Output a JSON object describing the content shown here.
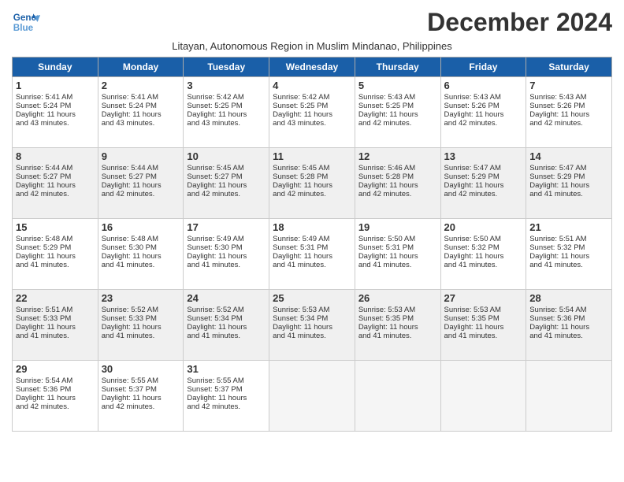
{
  "header": {
    "logo_line1": "General",
    "logo_line2": "Blue",
    "month_year": "December 2024",
    "location": "Litayan, Autonomous Region in Muslim Mindanao, Philippines"
  },
  "weekdays": [
    "Sunday",
    "Monday",
    "Tuesday",
    "Wednesday",
    "Thursday",
    "Friday",
    "Saturday"
  ],
  "weeks": [
    [
      {
        "day": 1,
        "lines": [
          "Sunrise: 5:41 AM",
          "Sunset: 5:24 PM",
          "Daylight: 11 hours",
          "and 43 minutes."
        ]
      },
      {
        "day": 2,
        "lines": [
          "Sunrise: 5:41 AM",
          "Sunset: 5:24 PM",
          "Daylight: 11 hours",
          "and 43 minutes."
        ]
      },
      {
        "day": 3,
        "lines": [
          "Sunrise: 5:42 AM",
          "Sunset: 5:25 PM",
          "Daylight: 11 hours",
          "and 43 minutes."
        ]
      },
      {
        "day": 4,
        "lines": [
          "Sunrise: 5:42 AM",
          "Sunset: 5:25 PM",
          "Daylight: 11 hours",
          "and 43 minutes."
        ]
      },
      {
        "day": 5,
        "lines": [
          "Sunrise: 5:43 AM",
          "Sunset: 5:25 PM",
          "Daylight: 11 hours",
          "and 42 minutes."
        ]
      },
      {
        "day": 6,
        "lines": [
          "Sunrise: 5:43 AM",
          "Sunset: 5:26 PM",
          "Daylight: 11 hours",
          "and 42 minutes."
        ]
      },
      {
        "day": 7,
        "lines": [
          "Sunrise: 5:43 AM",
          "Sunset: 5:26 PM",
          "Daylight: 11 hours",
          "and 42 minutes."
        ]
      }
    ],
    [
      {
        "day": 8,
        "lines": [
          "Sunrise: 5:44 AM",
          "Sunset: 5:27 PM",
          "Daylight: 11 hours",
          "and 42 minutes."
        ]
      },
      {
        "day": 9,
        "lines": [
          "Sunrise: 5:44 AM",
          "Sunset: 5:27 PM",
          "Daylight: 11 hours",
          "and 42 minutes."
        ]
      },
      {
        "day": 10,
        "lines": [
          "Sunrise: 5:45 AM",
          "Sunset: 5:27 PM",
          "Daylight: 11 hours",
          "and 42 minutes."
        ]
      },
      {
        "day": 11,
        "lines": [
          "Sunrise: 5:45 AM",
          "Sunset: 5:28 PM",
          "Daylight: 11 hours",
          "and 42 minutes."
        ]
      },
      {
        "day": 12,
        "lines": [
          "Sunrise: 5:46 AM",
          "Sunset: 5:28 PM",
          "Daylight: 11 hours",
          "and 42 minutes."
        ]
      },
      {
        "day": 13,
        "lines": [
          "Sunrise: 5:47 AM",
          "Sunset: 5:29 PM",
          "Daylight: 11 hours",
          "and 42 minutes."
        ]
      },
      {
        "day": 14,
        "lines": [
          "Sunrise: 5:47 AM",
          "Sunset: 5:29 PM",
          "Daylight: 11 hours",
          "and 41 minutes."
        ]
      }
    ],
    [
      {
        "day": 15,
        "lines": [
          "Sunrise: 5:48 AM",
          "Sunset: 5:29 PM",
          "Daylight: 11 hours",
          "and 41 minutes."
        ]
      },
      {
        "day": 16,
        "lines": [
          "Sunrise: 5:48 AM",
          "Sunset: 5:30 PM",
          "Daylight: 11 hours",
          "and 41 minutes."
        ]
      },
      {
        "day": 17,
        "lines": [
          "Sunrise: 5:49 AM",
          "Sunset: 5:30 PM",
          "Daylight: 11 hours",
          "and 41 minutes."
        ]
      },
      {
        "day": 18,
        "lines": [
          "Sunrise: 5:49 AM",
          "Sunset: 5:31 PM",
          "Daylight: 11 hours",
          "and 41 minutes."
        ]
      },
      {
        "day": 19,
        "lines": [
          "Sunrise: 5:50 AM",
          "Sunset: 5:31 PM",
          "Daylight: 11 hours",
          "and 41 minutes."
        ]
      },
      {
        "day": 20,
        "lines": [
          "Sunrise: 5:50 AM",
          "Sunset: 5:32 PM",
          "Daylight: 11 hours",
          "and 41 minutes."
        ]
      },
      {
        "day": 21,
        "lines": [
          "Sunrise: 5:51 AM",
          "Sunset: 5:32 PM",
          "Daylight: 11 hours",
          "and 41 minutes."
        ]
      }
    ],
    [
      {
        "day": 22,
        "lines": [
          "Sunrise: 5:51 AM",
          "Sunset: 5:33 PM",
          "Daylight: 11 hours",
          "and 41 minutes."
        ]
      },
      {
        "day": 23,
        "lines": [
          "Sunrise: 5:52 AM",
          "Sunset: 5:33 PM",
          "Daylight: 11 hours",
          "and 41 minutes."
        ]
      },
      {
        "day": 24,
        "lines": [
          "Sunrise: 5:52 AM",
          "Sunset: 5:34 PM",
          "Daylight: 11 hours",
          "and 41 minutes."
        ]
      },
      {
        "day": 25,
        "lines": [
          "Sunrise: 5:53 AM",
          "Sunset: 5:34 PM",
          "Daylight: 11 hours",
          "and 41 minutes."
        ]
      },
      {
        "day": 26,
        "lines": [
          "Sunrise: 5:53 AM",
          "Sunset: 5:35 PM",
          "Daylight: 11 hours",
          "and 41 minutes."
        ]
      },
      {
        "day": 27,
        "lines": [
          "Sunrise: 5:53 AM",
          "Sunset: 5:35 PM",
          "Daylight: 11 hours",
          "and 41 minutes."
        ]
      },
      {
        "day": 28,
        "lines": [
          "Sunrise: 5:54 AM",
          "Sunset: 5:36 PM",
          "Daylight: 11 hours",
          "and 41 minutes."
        ]
      }
    ],
    [
      {
        "day": 29,
        "lines": [
          "Sunrise: 5:54 AM",
          "Sunset: 5:36 PM",
          "Daylight: 11 hours",
          "and 42 minutes."
        ]
      },
      {
        "day": 30,
        "lines": [
          "Sunrise: 5:55 AM",
          "Sunset: 5:37 PM",
          "Daylight: 11 hours",
          "and 42 minutes."
        ]
      },
      {
        "day": 31,
        "lines": [
          "Sunrise: 5:55 AM",
          "Sunset: 5:37 PM",
          "Daylight: 11 hours",
          "and 42 minutes."
        ]
      },
      null,
      null,
      null,
      null
    ]
  ]
}
